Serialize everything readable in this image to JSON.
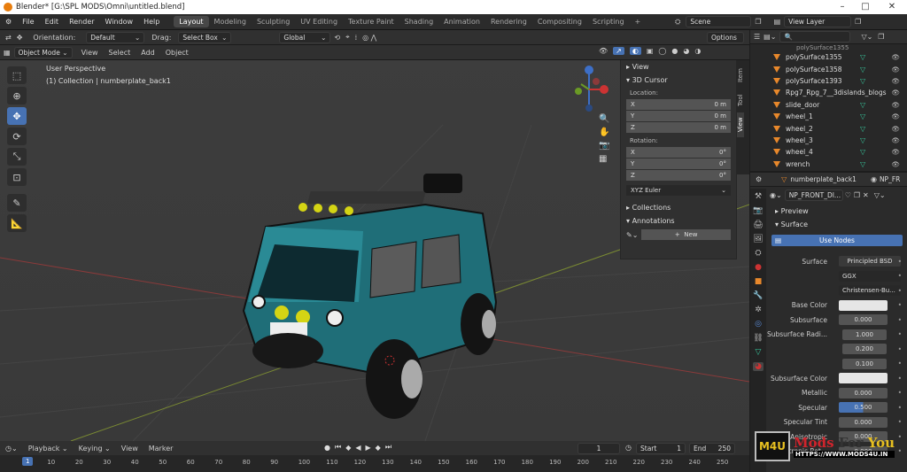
{
  "titlebar": {
    "title": "Blender* [G:\\SPL MODS\\Omni\\untitled.blend]"
  },
  "menu": [
    "File",
    "Edit",
    "Render",
    "Window",
    "Help"
  ],
  "workspaces": [
    "Layout",
    "Modeling",
    "Sculpting",
    "UV Editing",
    "Texture Paint",
    "Shading",
    "Animation",
    "Rendering",
    "Compositing",
    "Scripting"
  ],
  "active_workspace": "Layout",
  "scene": {
    "label": "Scene",
    "view_layer": "View Layer"
  },
  "tool_header": {
    "orientation_label": "Orientation:",
    "orientation_value": "Default",
    "drag_label": "Drag:",
    "drag_value": "Select Box",
    "transform": "Global",
    "options": "Options"
  },
  "view_header": {
    "mode": "Object Mode",
    "view": "View",
    "select": "Select",
    "add": "Add",
    "object": "Object"
  },
  "viewport": {
    "perspective": "User Perspective",
    "collection": "(1) Collection | numberplate_back1"
  },
  "npanel": {
    "view": "View",
    "cursor": "3D Cursor",
    "location_label": "Location:",
    "location": [
      {
        "axis": "X",
        "value": "0 m"
      },
      {
        "axis": "Y",
        "value": "0 m"
      },
      {
        "axis": "Z",
        "value": "0 m"
      }
    ],
    "rotation_label": "Rotation:",
    "rotation": [
      {
        "axis": "X",
        "value": "0°"
      },
      {
        "axis": "Y",
        "value": "0°"
      },
      {
        "axis": "Z",
        "value": "0°"
      }
    ],
    "rotation_mode": "XYZ Euler",
    "collections": "Collections",
    "annotations": "Annotations",
    "new_button": "New",
    "tabs": [
      "Item",
      "Tool",
      "View"
    ]
  },
  "outliner": {
    "items": [
      "polySurface1355",
      "polySurface1358",
      "polySurface1393",
      "Rpg7_Rpg_7__3dislands_blogs",
      "slide_door",
      "wheel_1",
      "wheel_2",
      "wheel_3",
      "wheel_4",
      "wrench"
    ],
    "partial_top": "polySurface1355"
  },
  "properties": {
    "object": "numberplate_back1",
    "object_trail": "NP_FR",
    "material": "NP_FRONT_DI...",
    "preview": "Preview",
    "surface_section": "Surface",
    "use_nodes": "Use Nodes",
    "rows": [
      {
        "label": "Surface",
        "value": "Principled BSD"
      },
      {
        "label": "",
        "value": "GGX"
      },
      {
        "label": "",
        "value": "Christensen-Bu..."
      },
      {
        "label": "Base Color",
        "value": ""
      },
      {
        "label": "Subsurface",
        "value": "0.000"
      },
      {
        "label": "Subsurface Radi...",
        "value": "1.000"
      },
      {
        "label": "",
        "value": "0.200"
      },
      {
        "label": "",
        "value": "0.100"
      },
      {
        "label": "Subsurface Color",
        "value": ""
      },
      {
        "label": "Metallic",
        "value": "0.000"
      },
      {
        "label": "Specular",
        "value": "0.500"
      },
      {
        "label": "Specular Tint",
        "value": "0.000"
      },
      {
        "label": "Anisotropic",
        "value": "0.000"
      },
      {
        "label": "Anisotropic Rot...",
        "value": "0.000"
      }
    ]
  },
  "timeline": {
    "playback": "Playback",
    "keying": "Keying",
    "view": "View",
    "marker": "Marker",
    "current_frame": "1",
    "start_label": "Start",
    "start": "1",
    "end_label": "End",
    "end": "250",
    "ticks": [
      "1",
      "10",
      "20",
      "30",
      "40",
      "50",
      "60",
      "70",
      "80",
      "90",
      "100",
      "110",
      "120",
      "130",
      "140",
      "150",
      "160",
      "170",
      "180",
      "190",
      "200",
      "210",
      "220",
      "230",
      "240",
      "250"
    ]
  },
  "watermark": {
    "logo": "M4U",
    "brand_a": "Mods",
    "brand_b": "For",
    "brand_c": "You",
    "url": "HTTPS://WWW.MODS4U.IN"
  },
  "colors": {
    "accent": "#4772b3",
    "orange": "#e87d0d",
    "mesh": "#37c49b",
    "van": "#1f6e78"
  }
}
